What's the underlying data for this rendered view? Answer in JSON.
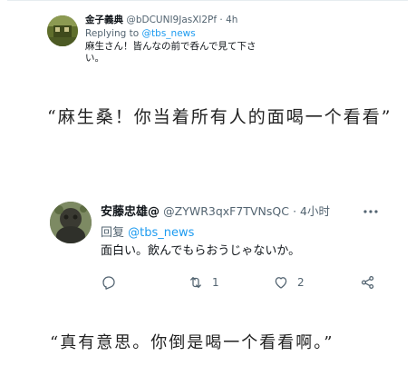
{
  "tweet1": {
    "name": "金子義典",
    "handle": "@bDCUNI9JasXl2Pf",
    "time": "· 4h",
    "replying_prefix": "Replying to ",
    "replying_to": "@tbs_news",
    "text": "麻生さん！皆んなの前で呑んで見て下さい。"
  },
  "quote1": "“麻生桑！你当着所有人的面喝一个看看”",
  "tweet2": {
    "name": "安藤忠雄@",
    "handle": "@ZYWR3qxF7TVNsQC",
    "time": "· 4小时",
    "replying_prefix": "回复 ",
    "replying_to": "@tbs_news",
    "text": "面白い。飲んでもらおうじゃないか。",
    "retweet_count": "1",
    "like_count": "2"
  },
  "quote2": "“真有意思。你倒是喝一个看看啊。”",
  "icons": {
    "reply": "reply-icon",
    "retweet": "retweet-icon",
    "like": "heart-icon",
    "share": "share-icon",
    "more": "more-icon"
  },
  "colors": {
    "link": "#1d9bf0",
    "secondary_text": "#536471",
    "primary_text": "#0f1419"
  }
}
